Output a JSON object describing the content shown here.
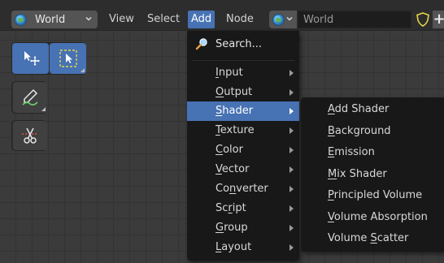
{
  "header": {
    "world_selector": {
      "label": "World",
      "icon": "world-globe-icon"
    },
    "menus": [
      {
        "label": "View"
      },
      {
        "label": "Select"
      },
      {
        "label": "Add",
        "active": true
      },
      {
        "label": "Node"
      }
    ],
    "world_field": {
      "value": "World"
    },
    "fake_user_icon": "shield-icon",
    "new_button": "+"
  },
  "toolbar": {
    "tools": [
      {
        "name": "move-tool",
        "icon": "move-cursor-icon",
        "active": true
      },
      {
        "name": "select-box-tool",
        "icon": "select-box-icon",
        "active": true
      },
      {
        "name": "annotate-tool",
        "icon": "annotate-pen-icon"
      },
      {
        "name": "links-cut-tool",
        "icon": "scissors-icon"
      }
    ]
  },
  "add_menu": {
    "search": {
      "label": "Search...",
      "icon": "search-icon"
    },
    "items": [
      {
        "label": "Input",
        "underline": "I",
        "rest": "nput"
      },
      {
        "label": "Output",
        "underline": "O",
        "rest": "utput"
      },
      {
        "label": "Shader",
        "underline": "S",
        "rest": "hader",
        "highlighted": true
      },
      {
        "label": "Texture",
        "underline": "T",
        "rest": "exture"
      },
      {
        "label": "Color",
        "underline": "C",
        "rest": "olor"
      },
      {
        "label": "Vector",
        "underline": "V",
        "rest": "ector"
      },
      {
        "label": "Converter",
        "pre": "Co",
        "underline": "n",
        "rest": "verter"
      },
      {
        "label": "Script",
        "pre": "Sc",
        "underline": "r",
        "rest": "ipt"
      },
      {
        "label": "Group",
        "underline": "G",
        "rest": "roup"
      },
      {
        "label": "Layout",
        "underline": "L",
        "rest": "ayout"
      }
    ]
  },
  "shader_menu": {
    "items": [
      {
        "label": "Add Shader",
        "underline": "A",
        "rest": "dd Shader"
      },
      {
        "label": "Background",
        "underline": "B",
        "rest": "ackground"
      },
      {
        "label": "Emission",
        "underline": "E",
        "rest": "mission"
      },
      {
        "label": "Mix Shader",
        "underline": "M",
        "rest": "ix Shader"
      },
      {
        "label": "Principled Volume",
        "underline": "P",
        "rest": "rincipled Volume"
      },
      {
        "label": "Volume Absorption",
        "underline": "V",
        "rest": "olume Absorption"
      },
      {
        "label": "Volume Scatter",
        "pre": "Volume ",
        "underline": "S",
        "rest": "catter"
      }
    ]
  },
  "colors": {
    "accent": "#4772b3",
    "menu_bg": "#181818",
    "header_bg": "#2d2d2d",
    "grid_bg": "#3b3b3b"
  }
}
